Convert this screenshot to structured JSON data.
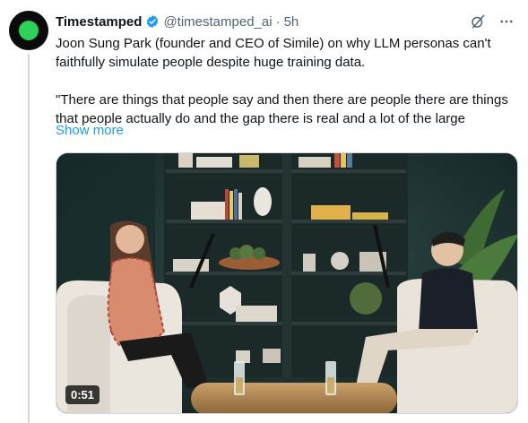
{
  "post": {
    "author_name": "Timestamped",
    "handle": "@timestamped_ai",
    "separator": "·",
    "time": "5h",
    "text": "Joon Sung Park (founder and CEO of Simile) on why LLM personas can't faithfully simulate people despite huge training data.\n\n\"There are things that people say and then there are people there are things that people actually do and the gap there is real and a lot of the large",
    "show_more": "Show more"
  },
  "media": {
    "type": "video",
    "duration": "0:51"
  },
  "icons": {
    "verified": "verified-badge-icon",
    "grok": "grok-icon",
    "more": "more-icon"
  },
  "colors": {
    "accent": "#1d9bf0",
    "text": "#0f1419",
    "muted": "#536471",
    "avatar_dot": "#2ed15a"
  }
}
